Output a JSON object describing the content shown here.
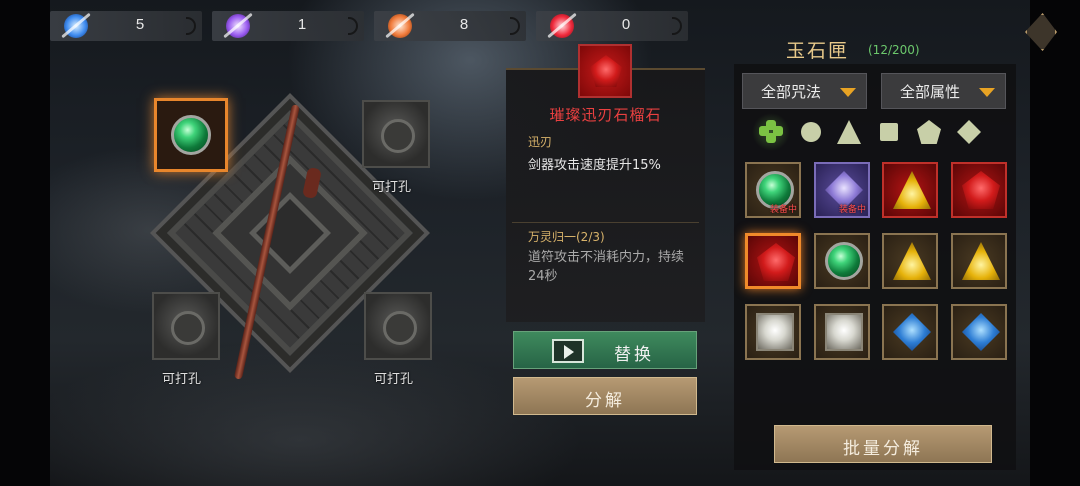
{
  "currencies": [
    {
      "icon": "blue-spirit-orb-icon",
      "value": "5",
      "color": "#5aa8ff"
    },
    {
      "icon": "purple-spirit-orb-icon",
      "value": "1",
      "color": "#b07cff"
    },
    {
      "icon": "orange-spirit-orb-icon",
      "value": "8",
      "color": "#ff8a4a"
    },
    {
      "icon": "red-spirit-orb-icon",
      "value": "0",
      "color": "#ff3b4a"
    }
  ],
  "sockets": {
    "empty_label": "可打孔"
  },
  "detail": {
    "name": "璀璨迅刃石榴石",
    "effect_title": "迅刃",
    "effect_desc": "剑器攻击速度提升15%",
    "set_title": "万灵归一(2/3)",
    "set_desc": "道符攻击不消耗内力，持续24秒"
  },
  "buttons": {
    "replace": "替换",
    "decompose": "分解",
    "batch_decompose": "批量分解"
  },
  "box": {
    "title": "玉石匣",
    "count": "(12/200)",
    "filter_spell": "全部咒法",
    "filter_attr": "全部属性"
  },
  "inventory": {
    "equipped_tag": "装备中",
    "items": [
      {
        "gem": "green-round-gem",
        "equipped": true
      },
      {
        "gem": "purple-diamond-gem",
        "equipped": true
      },
      {
        "gem": "yellow-triangle-gem",
        "equipped": false
      },
      {
        "gem": "red-pentagon-gem",
        "equipped": false
      },
      {
        "gem": "red-pentagon-gem",
        "equipped": false,
        "selected": true
      },
      {
        "gem": "green-round-gem",
        "equipped": false
      },
      {
        "gem": "yellow-triangle-gem",
        "equipped": false
      },
      {
        "gem": "yellow-triangle-gem",
        "equipped": false
      },
      {
        "gem": "white-square-gem",
        "equipped": false
      },
      {
        "gem": "white-square-gem",
        "equipped": false
      },
      {
        "gem": "blue-diamond-gem",
        "equipped": false
      },
      {
        "gem": "blue-diamond-gem",
        "equipped": false
      }
    ]
  },
  "colors": {
    "accent_orange": "#f08a2a",
    "gold_text": "#e8c98a",
    "red_name": "#e94040",
    "green_count": "#6cc86c"
  }
}
